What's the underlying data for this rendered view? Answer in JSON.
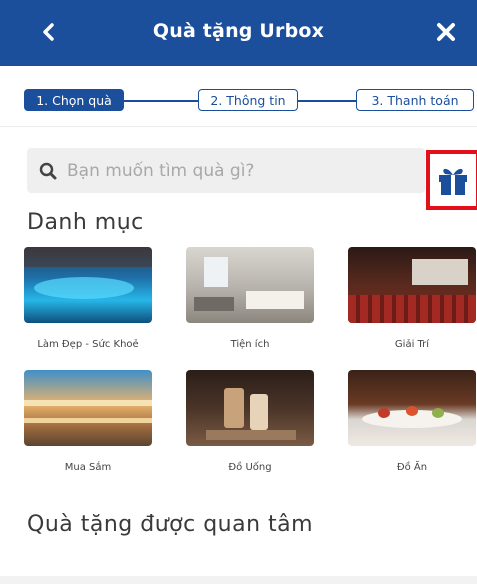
{
  "header": {
    "title": "Quà tặng Urbox"
  },
  "steps": [
    {
      "label": "1. Chọn quà"
    },
    {
      "label": "2. Thông tin"
    },
    {
      "label": "3. Thanh toán"
    }
  ],
  "search": {
    "placeholder": "Bạn muốn tìm quà gì?"
  },
  "categories_title": "Danh mục",
  "categories": [
    {
      "label": "Làm Đẹp - Sức Khoẻ",
      "icon": "spa-pool-photo"
    },
    {
      "label": "Tiện ích",
      "icon": "hotel-room-photo"
    },
    {
      "label": "Giải Trí",
      "icon": "cinema-photo"
    },
    {
      "label": "Mua Sắm",
      "icon": "shopping-mall-photo"
    },
    {
      "label": "Đồ Uống",
      "icon": "coffee-drinks-photo"
    },
    {
      "label": "Đồ Ăn",
      "icon": "food-plate-photo"
    }
  ],
  "featured_title": "Quà tặng được quan tâm",
  "colors": {
    "brand": "#1b4e9b",
    "highlight": "#e3101b"
  }
}
